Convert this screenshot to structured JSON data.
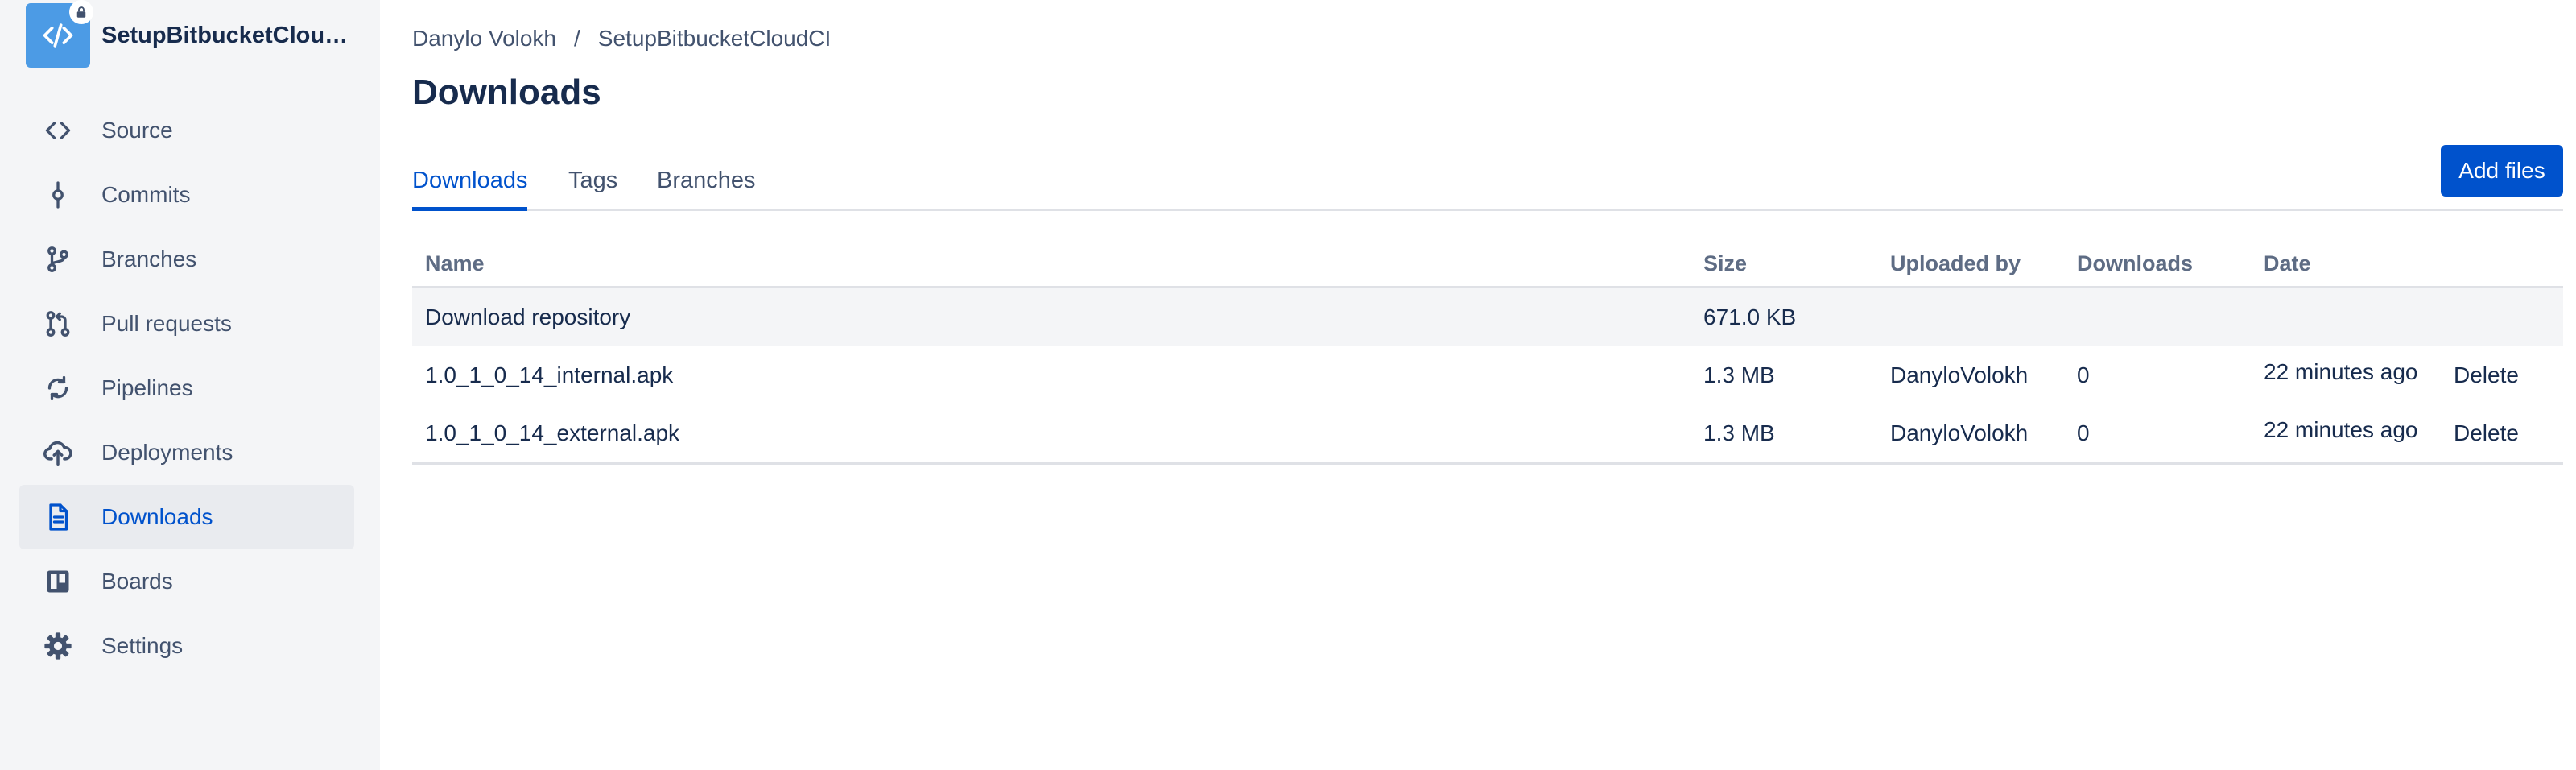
{
  "sidebar": {
    "repo_name": "SetupBitbucketCloudCI",
    "items": [
      {
        "label": "Source",
        "icon": "code-icon"
      },
      {
        "label": "Commits",
        "icon": "commit-icon"
      },
      {
        "label": "Branches",
        "icon": "branch-icon"
      },
      {
        "label": "Pull requests",
        "icon": "pull-request-icon"
      },
      {
        "label": "Pipelines",
        "icon": "pipelines-icon"
      },
      {
        "label": "Deployments",
        "icon": "cloud-upload-icon"
      },
      {
        "label": "Downloads",
        "icon": "document-icon",
        "active": true
      },
      {
        "label": "Boards",
        "icon": "board-icon"
      },
      {
        "label": "Settings",
        "icon": "gear-icon"
      }
    ]
  },
  "breadcrumb": {
    "owner": "Danylo Volokh",
    "separator": "/",
    "repo": "SetupBitbucketCloudCI"
  },
  "page": {
    "title": "Downloads"
  },
  "tabs": [
    {
      "label": "Downloads",
      "active": true
    },
    {
      "label": "Tags"
    },
    {
      "label": "Branches"
    }
  ],
  "actions": {
    "add_files": "Add files"
  },
  "table": {
    "headers": {
      "name": "Name",
      "size": "Size",
      "uploaded_by": "Uploaded by",
      "downloads": "Downloads",
      "date": "Date"
    },
    "rows": [
      {
        "name": "Download repository",
        "size": "671.0 KB",
        "uploaded_by": "",
        "downloads": "",
        "date": "",
        "action": ""
      },
      {
        "name": "1.0_1_0_14_internal.apk",
        "size": "1.3 MB",
        "uploaded_by": "DanyloVolokh",
        "downloads": "0",
        "date": "22 minutes ago",
        "action": "Delete"
      },
      {
        "name": "1.0_1_0_14_external.apk",
        "size": "1.3 MB",
        "uploaded_by": "DanyloVolokh",
        "downloads": "0",
        "date": "22 minutes ago",
        "action": "Delete"
      }
    ]
  },
  "colors": {
    "primary": "#0052cc",
    "sidebar_bg": "#f4f5f7",
    "text": "#172b4d",
    "muted": "#42526e"
  }
}
